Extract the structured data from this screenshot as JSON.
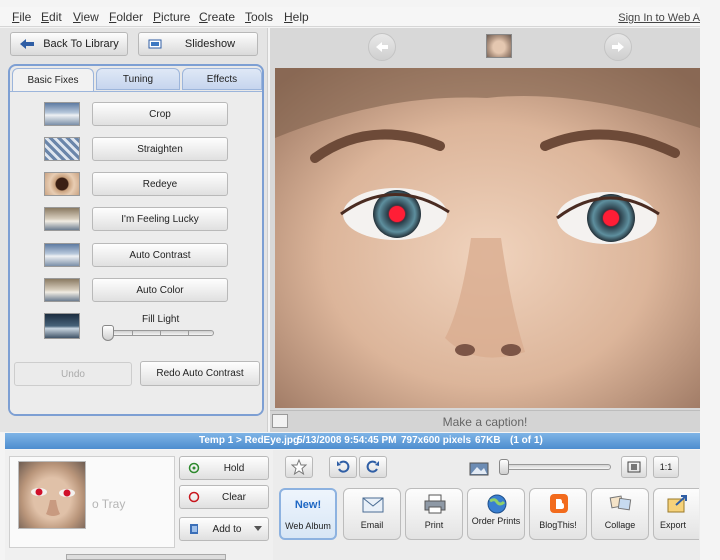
{
  "menubar": {
    "items": [
      "File",
      "Edit",
      "View",
      "Folder",
      "Picture",
      "Create",
      "Tools",
      "Help"
    ],
    "signin": "Sign In to Web A"
  },
  "toolbar": {
    "back_label": "Back To Library",
    "slideshow_label": "Slideshow"
  },
  "tabs": [
    "Basic Fixes",
    "Tuning",
    "Effects"
  ],
  "fixes": [
    "Crop",
    "Straighten",
    "Redeye",
    "I'm Feeling Lucky",
    "Auto Contrast",
    "Auto Color"
  ],
  "fill_light": {
    "label": "Fill Light",
    "level": 0
  },
  "undo_label": "Undo",
  "redo_label": "Redo Auto Contrast",
  "caption_placeholder": "Make a caption!",
  "status": {
    "path": "Temp 1 > RedEye.jpg",
    "date": "5/13/2008 9:54:45 PM",
    "dimensions": "797x600 pixels",
    "size": "67KB",
    "count": "(1 of 1)"
  },
  "tray": {
    "text": "o Tray",
    "hold_label": "Hold",
    "clear_label": "Clear",
    "add_label": "Add to"
  },
  "zoom_mode": "1:1",
  "share_tools": [
    "Web Album",
    "Email",
    "Print",
    "Order Prints",
    "BlogThis!",
    "Collage",
    "Export"
  ],
  "new_badge": "New!",
  "colors": {
    "accent": "#5a97d6",
    "tab_border": "#7d9fd3",
    "redeye": "#e0102a"
  }
}
